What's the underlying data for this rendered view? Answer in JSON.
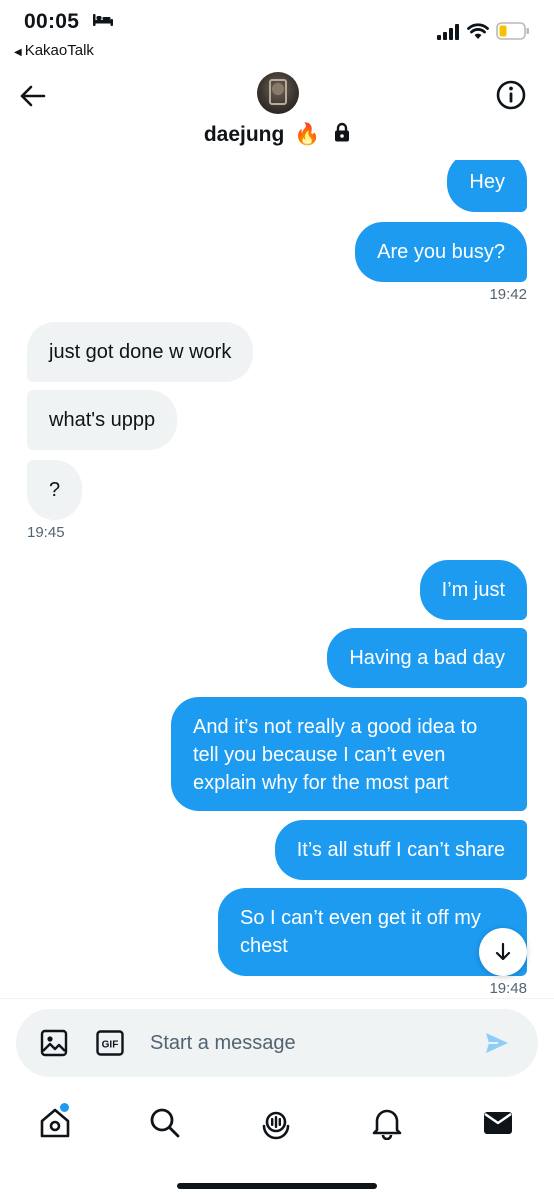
{
  "status_bar": {
    "time": "00:05",
    "back_app": "KakaoTalk",
    "icons": [
      "bed-icon",
      "signal-icon",
      "wifi-icon",
      "battery-icon"
    ],
    "battery_color": "#f5c400"
  },
  "header": {
    "contact_name": "daejung",
    "name_emoji": "🔥",
    "icons": [
      "back-arrow-icon",
      "info-icon",
      "lock-icon"
    ]
  },
  "messages": [
    {
      "side": "out",
      "text": "Hey"
    },
    {
      "side": "out",
      "text": "Are you busy?"
    },
    {
      "timestamp": "19:42"
    },
    {
      "side": "in",
      "text": "just got done w work"
    },
    {
      "side": "in",
      "text": "what's uppp"
    },
    {
      "side": "in",
      "text": "?"
    },
    {
      "timestamp": "19:45"
    },
    {
      "side": "out",
      "text": "I’m just"
    },
    {
      "side": "out",
      "text": "Having a bad day"
    },
    {
      "side": "out",
      "lines": [
        "And it’s not really a good idea to",
        "tell you because I can’t even",
        "explain why for the most part"
      ]
    },
    {
      "side": "out",
      "text": "It’s all stuff I can’t share"
    },
    {
      "side": "out",
      "lines": [
        "So I can’t even get it off my",
        "chest"
      ]
    },
    {
      "timestamp": "19:48"
    }
  ],
  "timestamps": {
    "t1": "19:42",
    "t2": "19:45",
    "t3": "19:48"
  },
  "composer": {
    "placeholder": "Start a message",
    "gif_label": "GIF",
    "icons": [
      "image-icon",
      "gif-icon",
      "send-icon"
    ]
  },
  "tab_bar": {
    "items": [
      "home-icon",
      "search-icon",
      "spaces-icon",
      "notifications-icon",
      "messages-icon"
    ],
    "active": "messages-icon"
  },
  "colors": {
    "accent": "#1d9bf0",
    "incoming_bubble": "#eff3f4",
    "text": "#0f1419",
    "secondary_text": "#536471"
  }
}
